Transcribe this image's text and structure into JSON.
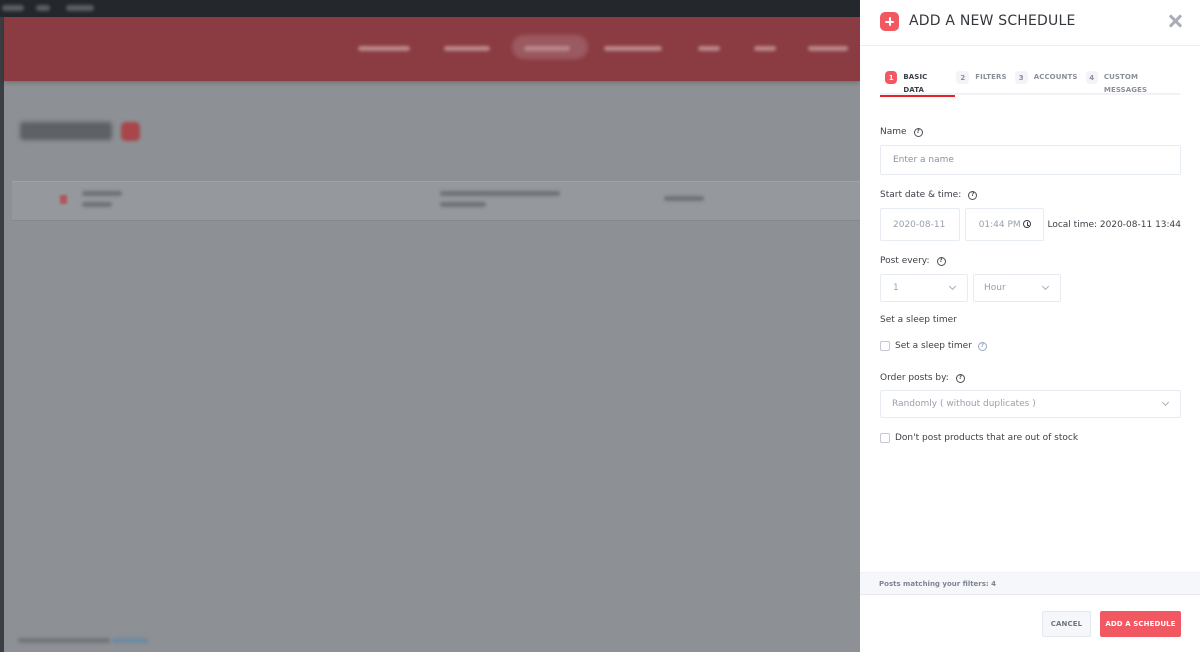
{
  "background": {
    "note_blurred": true,
    "accent_color": "#8b3c42"
  },
  "panel": {
    "title": "ADD A NEW SCHEDULE",
    "accent_color": "#f25862",
    "tabs": [
      {
        "number": "1",
        "label": "BASIC DATA",
        "active": true
      },
      {
        "number": "2",
        "label": "FILTERS",
        "active": false
      },
      {
        "number": "3",
        "label": "ACCOUNTS",
        "active": false
      },
      {
        "number": "4",
        "label": "CUSTOM MESSAGES",
        "active": false
      }
    ],
    "form": {
      "name_label": "Name",
      "name_placeholder": "Enter a name",
      "start_label": "Start date & time:",
      "start_date": "2020-08-11",
      "start_time": "01:44 PM",
      "local_time": "Local time: 2020-08-11 13:44",
      "post_every_label": "Post every:",
      "post_every_value": "1",
      "post_every_unit": "Hour",
      "sleep_timer_section": "Set a sleep timer",
      "sleep_timer_checkbox": "Set a sleep timer",
      "order_label": "Order posts by:",
      "order_value": "Randomly ( without duplicates )",
      "out_of_stock_checkbox": "Don't post products that are out of stock"
    },
    "matching_text": "Posts matching your filters: 4",
    "cancel_label": "CANCEL",
    "submit_label": "ADD A SCHEDULE"
  }
}
